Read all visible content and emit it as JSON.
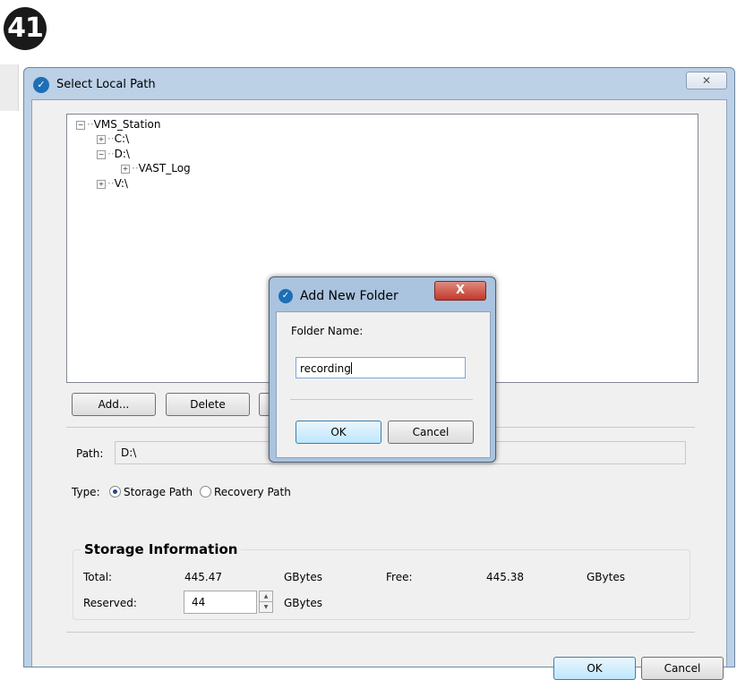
{
  "step_number": "41",
  "window": {
    "title": "Select Local Path",
    "close_glyph": "✕",
    "logo_icon": "vivotek-logo-icon"
  },
  "tree": [
    {
      "label": "VMS_Station",
      "expander": "−"
    },
    {
      "label": "C:\\",
      "expander": "+"
    },
    {
      "label": "D:\\",
      "expander": "−"
    },
    {
      "label": "VAST_Log",
      "expander": "+"
    },
    {
      "label": "V:\\",
      "expander": "+"
    }
  ],
  "buttons": {
    "add": "Add...",
    "delete": "Delete",
    "ok": "OK",
    "cancel": "Cancel"
  },
  "path": {
    "label": "Path:",
    "value": "D:\\"
  },
  "type": {
    "label": "Type:",
    "storage": "Storage Path",
    "recovery": "Recovery Path",
    "selected": "Storage Path"
  },
  "storage_info": {
    "title": "Storage Information",
    "total_label": "Total:",
    "total_value": "445.47",
    "total_unit": "GBytes",
    "free_label": "Free:",
    "free_value": "445.38",
    "free_unit": "GBytes",
    "reserved_label": "Reserved:",
    "reserved_value": "44",
    "reserved_unit": "GBytes"
  },
  "dialog": {
    "title": "Add New Folder",
    "close_glyph": "X",
    "field_label": "Folder Name:",
    "field_value": "recording",
    "ok": "OK",
    "cancel": "Cancel"
  }
}
